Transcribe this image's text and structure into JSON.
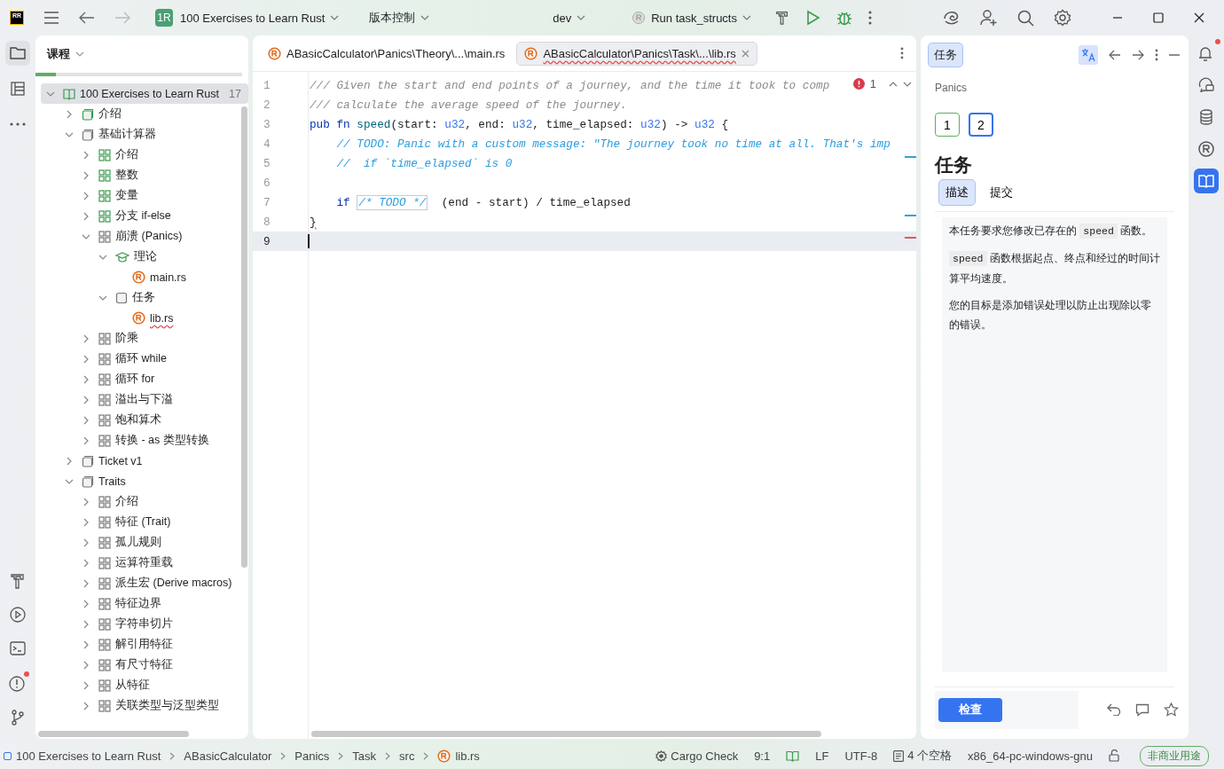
{
  "titlebar": {
    "logo": "RR",
    "project_badge": "1R",
    "project": "100 Exercises to Learn Rust",
    "vcs": "版本控制",
    "branch": "dev",
    "run_config": "Run task_structs",
    "forward_disabled": true
  },
  "left_toolbar": [
    {
      "selected": true
    },
    {
      "selected": false
    },
    {
      "selected": false
    }
  ],
  "left_toolbar_bottom": [
    {
      "alert": false
    },
    {
      "alert": false
    },
    {
      "alert": false
    },
    {
      "alert": true
    },
    {
      "alert": false
    }
  ],
  "course_panel": {
    "title": "课程",
    "progress": {
      "level": 0.1
    },
    "tree": [
      {
        "label": "100 Exercises to Learn Rust",
        "count": "17",
        "kind": "course",
        "expanded": true,
        "selected": true,
        "solved": true,
        "children": [
          {
            "label": "介绍",
            "kind": "section",
            "expanded": false,
            "selected": false,
            "solved": true
          },
          {
            "label": "基础计算器",
            "kind": "section",
            "expanded": true,
            "selected": false,
            "solved": false,
            "children": [
              {
                "label": "介绍",
                "kind": "lesson",
                "expanded": false,
                "selected": false,
                "solved": true
              },
              {
                "label": "整数",
                "kind": "lesson",
                "expanded": false,
                "selected": false,
                "solved": true
              },
              {
                "label": "变量",
                "kind": "lesson",
                "expanded": false,
                "selected": false,
                "solved": true
              },
              {
                "label": "分支 if-else",
                "kind": "lesson",
                "expanded": false,
                "selected": false,
                "solved": true
              },
              {
                "label": "崩溃 (Panics)",
                "kind": "lesson",
                "expanded": true,
                "selected": false,
                "solved": false,
                "children": [
                  {
                    "label": "理论",
                    "kind": "theory",
                    "expanded": true,
                    "selected": false,
                    "solved": true,
                    "children": [
                      {
                        "label": "main.rs",
                        "kind": "file",
                        "selected": false,
                        "has_error": false
                      }
                    ]
                  },
                  {
                    "label": "任务",
                    "kind": "task",
                    "expanded": true,
                    "selected": false,
                    "solved": false,
                    "children": [
                      {
                        "label": "lib.rs",
                        "kind": "file",
                        "selected": false,
                        "has_error": true
                      }
                    ]
                  }
                ]
              },
              {
                "label": "阶乘",
                "kind": "lesson",
                "expanded": false,
                "selected": false,
                "solved": false
              },
              {
                "label": "循环 while",
                "kind": "lesson",
                "expanded": false,
                "selected": false,
                "solved": false
              },
              {
                "label": "循环 for",
                "kind": "lesson",
                "expanded": false,
                "selected": false,
                "solved": false
              },
              {
                "label": "溢出与下溢",
                "kind": "lesson",
                "expanded": false,
                "selected": false,
                "solved": false
              },
              {
                "label": "饱和算术",
                "kind": "lesson",
                "expanded": false,
                "selected": false,
                "solved": false
              },
              {
                "label": "转换 - as 类型转换",
                "kind": "lesson",
                "expanded": false,
                "selected": false,
                "solved": false
              }
            ]
          },
          {
            "label": "Ticket v1",
            "kind": "section",
            "expanded": false,
            "selected": false,
            "solved": false
          },
          {
            "label": "Traits",
            "kind": "section",
            "expanded": true,
            "selected": false,
            "solved": false,
            "children": [
              {
                "label": "介绍",
                "kind": "lesson",
                "expanded": false,
                "selected": false,
                "solved": false
              },
              {
                "label": "特征 (Trait)",
                "kind": "lesson",
                "expanded": false,
                "selected": false,
                "solved": false
              },
              {
                "label": "孤儿规则",
                "kind": "lesson",
                "expanded": false,
                "selected": false,
                "solved": false
              },
              {
                "label": "运算符重载",
                "kind": "lesson",
                "expanded": false,
                "selected": false,
                "solved": false
              },
              {
                "label": "派生宏 (Derive macros)",
                "kind": "lesson",
                "expanded": false,
                "selected": false,
                "solved": false
              },
              {
                "label": "特征边界",
                "kind": "lesson",
                "expanded": false,
                "selected": false,
                "solved": false
              },
              {
                "label": "字符串切片",
                "kind": "lesson",
                "expanded": false,
                "selected": false,
                "solved": false
              },
              {
                "label": "解引用特征",
                "kind": "lesson",
                "expanded": false,
                "selected": false,
                "solved": false
              },
              {
                "label": "有尺寸特征",
                "kind": "lesson",
                "expanded": false,
                "selected": false,
                "solved": false
              },
              {
                "label": "从特征",
                "kind": "lesson",
                "expanded": false,
                "selected": false,
                "solved": false
              },
              {
                "label": "关联类型与泛型类型",
                "kind": "lesson",
                "expanded": false,
                "selected": false,
                "solved": false
              }
            ]
          }
        ]
      }
    ]
  },
  "editor": {
    "tabs": [
      {
        "label": "ABasicCalculator\\Panics\\Theory\\...\\main.rs",
        "selected": false,
        "has_error": false
      },
      {
        "label": "ABasicCalculator\\Panics\\Task\\...\\lib.rs",
        "selected": true,
        "has_error": true
      }
    ],
    "error_count": "1",
    "lines": [
      {
        "number": "1",
        "current": false,
        "change_marker": false,
        "error_marker": false,
        "segments": [
          {
            "kind": "doc",
            "text": "/// Given the start and end points of a journey, and the time it took to comp"
          }
        ]
      },
      {
        "number": "2",
        "current": false,
        "change_marker": false,
        "error_marker": false,
        "segments": [
          {
            "kind": "doc",
            "text": "/// calculate the average speed of the journey."
          }
        ]
      },
      {
        "number": "3",
        "current": false,
        "change_marker": false,
        "error_marker": false,
        "segments": [
          {
            "kind": "kw",
            "text": "pub fn "
          },
          {
            "kind": "fn",
            "text": "speed"
          },
          {
            "kind": "plain",
            "text": "(start: "
          },
          {
            "kind": "type",
            "text": "u32"
          },
          {
            "kind": "plain",
            "text": ", end: "
          },
          {
            "kind": "type",
            "text": "u32"
          },
          {
            "kind": "plain",
            "text": ", time_elapsed: "
          },
          {
            "kind": "type",
            "text": "u32"
          },
          {
            "kind": "plain",
            "text": ") -> "
          },
          {
            "kind": "type",
            "text": "u32"
          },
          {
            "kind": "plain",
            "text": " {"
          }
        ]
      },
      {
        "number": "4",
        "current": false,
        "change_marker": false,
        "error_marker": false,
        "segments": [
          {
            "kind": "comment",
            "text": "    // TODO: Panic with a custom message: \"The journey took no time at all. That's imp"
          }
        ]
      },
      {
        "number": "5",
        "current": false,
        "change_marker": true,
        "error_marker": false,
        "segments": [
          {
            "kind": "comment",
            "text": "    //  if `time_elapsed` is 0"
          }
        ]
      },
      {
        "number": "6",
        "current": false,
        "change_marker": false,
        "error_marker": false
      },
      {
        "number": "7",
        "current": false,
        "change_marker": false,
        "error_marker": false,
        "segments": [
          {
            "kind": "kw",
            "text": "    if "
          },
          {
            "kind": "placeholder",
            "text": "/* TODO */"
          },
          {
            "kind": "plain",
            "text": "  (end - start) / time_elapsed"
          }
        ]
      },
      {
        "number": "8",
        "current": false,
        "change_marker": true,
        "error_marker": false,
        "segments": [
          {
            "kind": "error",
            "text": "}"
          }
        ]
      },
      {
        "number": "9",
        "current": true,
        "change_marker": false,
        "error_marker": true
      }
    ]
  },
  "task_panel": {
    "tab": "任务",
    "breadcrumb": "Panics",
    "steps": [
      {
        "label": "1",
        "solved": true,
        "selected": false
      },
      {
        "label": "2",
        "solved": false,
        "selected": true
      }
    ],
    "heading": "任务",
    "tabs": [
      {
        "label": "描述",
        "selected": true
      },
      {
        "label": "提交",
        "selected": false
      }
    ],
    "paragraphs": [
      [
        {
          "code": false,
          "text": "本任务要求您修改已存在的 "
        },
        {
          "code": true,
          "text": "speed"
        },
        {
          "code": false,
          "text": " 函数。"
        }
      ],
      [
        {
          "code": true,
          "text": "speed"
        },
        {
          "code": false,
          "text": " 函数根据起点、终点和经过的时间计算平均速度。"
        }
      ],
      [
        {
          "code": false,
          "text": "您的目标是添加错误处理以防止出现除以零的错误。"
        }
      ]
    ],
    "check_button": "检查"
  },
  "right_toolbar": [
    {
      "alert": true,
      "selected": false
    },
    {
      "alert": false,
      "selected": false
    },
    {
      "alert": false,
      "selected": false
    },
    {
      "alert": false,
      "selected": false
    },
    {
      "alert": false,
      "selected": true
    }
  ],
  "status_bar": {
    "breadcrumbs": [
      {
        "label": "100 Exercises to Learn Rust",
        "kind": "project"
      },
      {
        "label": "ABasicCalculator",
        "kind": "folder"
      },
      {
        "label": "Panics",
        "kind": "folder"
      },
      {
        "label": "Task",
        "kind": "folder"
      },
      {
        "label": "src",
        "kind": "folder"
      },
      {
        "label": "lib.rs",
        "kind": "file"
      }
    ],
    "items": [
      {
        "label": "Cargo Check",
        "kind": "gear"
      },
      {
        "label": "9:1",
        "kind": "text"
      },
      {
        "kind": "book"
      },
      {
        "label": "LF",
        "kind": "text"
      },
      {
        "label": "UTF-8",
        "kind": "text"
      },
      {
        "label": "4 个空格",
        "kind": "indent"
      },
      {
        "label": "x86_64-pc-windows-gnu",
        "kind": "text"
      },
      {
        "kind": "lock"
      }
    ],
    "license": "非商业用途"
  }
}
